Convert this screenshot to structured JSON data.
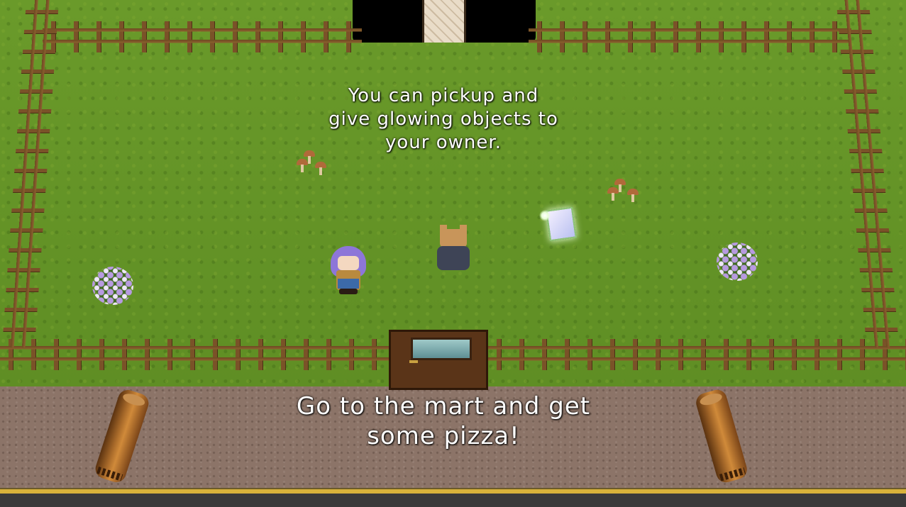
{
  "hints": {
    "pickup_hint": "You can pickup and\ngive glowing objects to\nyour owner.",
    "quest_hint": "Go to the mart and get\nsome pizza!"
  },
  "colors": {
    "grass": "#6a9a2a",
    "dirt_road": "#8c7468",
    "road_line": "#d8b23a",
    "fence": "#7a5228",
    "text": "#ffffff"
  },
  "sprites": {
    "player": "dog-character",
    "npc": "purple-haired-girl-owner",
    "glowing_object": "glowing-letter",
    "decor": [
      "mushrooms",
      "mushrooms",
      "flower-bush",
      "flower-bush",
      "log",
      "log"
    ]
  }
}
